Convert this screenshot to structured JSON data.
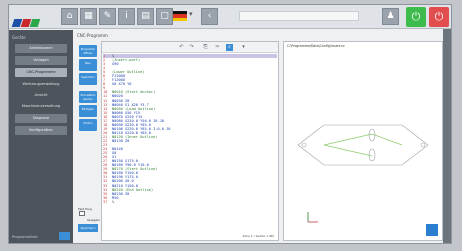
{
  "toolbar": {
    "logo_colors": [
      "#1c4fa8",
      "#c9272c",
      "#2aa84a"
    ],
    "language_caret": "▾",
    "top_field_value": "",
    "accept_color": "#3dbb4c",
    "cancel_color": "#e24d4d"
  },
  "leftnav": {
    "header": "Geräte",
    "items": [
      {
        "label": "Artikelstamm",
        "active": false
      },
      {
        "label": "Vorlagen",
        "active": false
      },
      {
        "label": "CNC-Programme",
        "active": true
      }
    ],
    "plain_items": [
      "Werkzeugverwaltung",
      "Ansicht",
      "Maschinenverwaltung",
      "Diagnose",
      "Konfiguration"
    ],
    "footer": "Programmliste"
  },
  "editor": {
    "panel_title": "CNC-Programm",
    "side_buttons": [
      "Programm öffnen",
      "Neu",
      "Speichern",
      "Simulation starten",
      "Einfügen",
      "Prüfen"
    ],
    "checkbox_title": "Fast Prog",
    "checkbox_label": "Spiegeln",
    "bottom_button": "Speichern",
    "status": "Zeile 1 / Spalte 1  INS",
    "lines": [
      {
        "n": "1",
        "text": "%",
        "cls": "tx",
        "hl": true
      },
      {
        "n": "2",
        "text": "(Insert-part)",
        "cls": "cmt"
      },
      {
        "n": "3",
        "text": "G90",
        "cls": "kw"
      },
      {
        "n": "4",
        "text": "",
        "cls": "tx"
      },
      {
        "n": "5",
        "text": "(Lower Outline)",
        "cls": "cmt"
      },
      {
        "n": "6",
        "text": "F12000",
        "cls": "kw"
      },
      {
        "n": "7",
        "text": "F12000",
        "cls": "kw"
      },
      {
        "n": "8",
        "text": "G0 X70 Y0",
        "cls": "kw"
      },
      {
        "n": "9",
        "text": "",
        "cls": "tx"
      },
      {
        "n": "10",
        "text": "N0010 (Start Anchor)",
        "cls": "cmt"
      },
      {
        "n": "11",
        "text": "N0020",
        "cls": "kw"
      },
      {
        "n": "12",
        "text": "N0030 Z0",
        "cls": "kw"
      },
      {
        "n": "13",
        "text": "N0040 G1 X20 Y3.7",
        "cls": "kw"
      },
      {
        "n": "14",
        "text": "N0050 (Load Outline)",
        "cls": "cmt"
      },
      {
        "n": "15",
        "text": "N0060 X50 Y15",
        "cls": "kw"
      },
      {
        "n": "16",
        "text": "N0070 X220 Y15",
        "cls": "kw"
      },
      {
        "n": "17",
        "text": "N0080 X220.0 Y50.0 I0 J0",
        "cls": "kw"
      },
      {
        "n": "18",
        "text": "N0090 X220.0 Y85.0",
        "cls": "kw"
      },
      {
        "n": "19",
        "text": "N0100 X220.0 Y85.0 I-0.0 J0",
        "cls": "kw"
      },
      {
        "n": "20",
        "text": "N0110 X220.0 Y85.0",
        "cls": "kw"
      },
      {
        "n": "21",
        "text": "N0120 (Inner Outline)",
        "cls": "cmt"
      },
      {
        "n": "22",
        "text": "N0130 Z0",
        "cls": "kw"
      },
      {
        "n": "23",
        "text": "",
        "cls": "tx"
      },
      {
        "n": "24",
        "text": "N0140",
        "cls": "kw"
      },
      {
        "n": "25",
        "text": "G0",
        "cls": "kw"
      },
      {
        "n": "26",
        "text": "G1",
        "cls": "kw"
      },
      {
        "n": "27",
        "text": "N0150 X175.0",
        "cls": "kw"
      },
      {
        "n": "28",
        "text": "N0160 Y90.0 Y10.0",
        "cls": "kw"
      },
      {
        "n": "29",
        "text": "N0170 (Start Outline)",
        "cls": "cmt"
      },
      {
        "n": "30",
        "text": "N0180 Y150.0",
        "cls": "kw"
      },
      {
        "n": "31",
        "text": "N0190 Y175.0",
        "cls": "kw"
      },
      {
        "n": "32",
        "text": "N0200 X0.0",
        "cls": "kw"
      },
      {
        "n": "33",
        "text": "N0210 Y150.0",
        "cls": "kw"
      },
      {
        "n": "34",
        "text": "N0220 (End Outline)",
        "cls": "cmt"
      },
      {
        "n": "35",
        "text": "N0230 Z0",
        "cls": "kw"
      },
      {
        "n": "36",
        "text": "M30",
        "cls": "kw"
      },
      {
        "n": "37",
        "text": "%",
        "cls": "tx"
      }
    ]
  },
  "preview": {
    "title": "C:\\Programme\\Data\\Config\\Insert.nc"
  }
}
